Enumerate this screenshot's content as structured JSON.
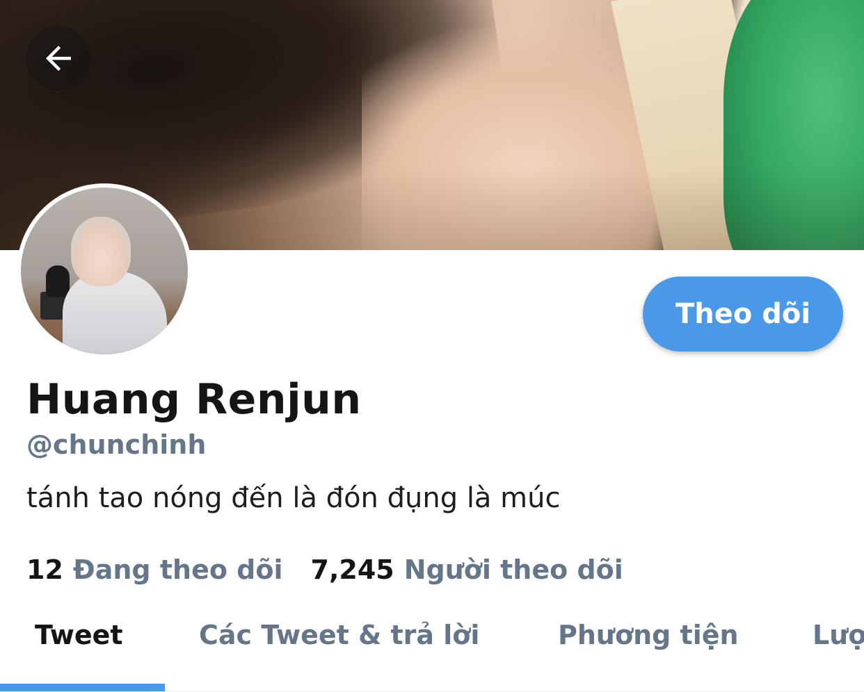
{
  "header": {
    "back_icon": "arrow-left-icon",
    "banner_alt": "profile banner photo"
  },
  "profile": {
    "display_name": "Huang Renjun",
    "handle": "@chunchinh",
    "bio": "tánh tao nóng đến là đón đụng là múc",
    "avatar_alt": "profile avatar"
  },
  "actions": {
    "follow_label": "Theo dõi"
  },
  "stats": {
    "following_count": "12",
    "following_label": "Đang theo dõi",
    "followers_count": "7,245",
    "followers_label": "Người theo dõi"
  },
  "tabs": [
    {
      "label": "Tweet",
      "active": true
    },
    {
      "label": "Các Tweet & trả lời",
      "active": false
    },
    {
      "label": "Phương tiện",
      "active": false
    },
    {
      "label": "Lượt thích",
      "active": false
    }
  ],
  "colors": {
    "accent": "#4a98e8",
    "text_primary": "#151515",
    "text_secondary": "#66768a"
  }
}
